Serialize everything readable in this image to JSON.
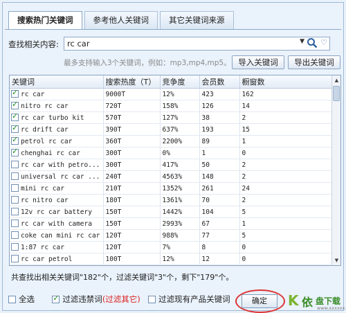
{
  "tabs": [
    "搜索热门关键词",
    "参考他人关键词",
    "其它关键词来源"
  ],
  "search": {
    "label": "查找相关内容:",
    "value": "rc car",
    "hint": "最多支持输入3个关键词，例如：mp3,mp4,mp5。",
    "import_label": "导入关键词",
    "export_label": "导出关键词"
  },
  "icons": {
    "dropdown": "chevron-down-icon",
    "search": "search-icon",
    "favorite": "heart-icon"
  },
  "table": {
    "columns": [
      "关键词",
      "搜索热度（T）",
      "竞争度",
      "会员数",
      "橱窗数"
    ],
    "rows": [
      {
        "checked": true,
        "kw": "rc car",
        "heat": "9000T",
        "comp": "12%",
        "members": "423",
        "windows": "162"
      },
      {
        "checked": true,
        "kw": "nitro rc car",
        "heat": "720T",
        "comp": "158%",
        "members": "126",
        "windows": "14"
      },
      {
        "checked": true,
        "kw": "rc car turbo kit",
        "heat": "570T",
        "comp": "127%",
        "members": "38",
        "windows": "2"
      },
      {
        "checked": true,
        "kw": "rc drift car",
        "heat": "390T",
        "comp": "637%",
        "members": "193",
        "windows": "15"
      },
      {
        "checked": true,
        "kw": "petrol rc car",
        "heat": "360T",
        "comp": "2200%",
        "members": "89",
        "windows": "1"
      },
      {
        "checked": true,
        "kw": "chenghai rc car",
        "heat": "300T",
        "comp": "0%",
        "members": "1",
        "windows": "0"
      },
      {
        "checked": false,
        "kw": "rc car with petro...",
        "heat": "300T",
        "comp": "417%",
        "members": "50",
        "windows": "2"
      },
      {
        "checked": false,
        "kw": "universal rc car ...",
        "heat": "240T",
        "comp": "4563%",
        "members": "148",
        "windows": "2"
      },
      {
        "checked": false,
        "kw": "mini rc car",
        "heat": "210T",
        "comp": "1352%",
        "members": "261",
        "windows": "24"
      },
      {
        "checked": false,
        "kw": "rc nitro car",
        "heat": "180T",
        "comp": "1361%",
        "members": "70",
        "windows": "2"
      },
      {
        "checked": false,
        "kw": "12v rc car battery",
        "heat": "150T",
        "comp": "1442%",
        "members": "104",
        "windows": "5"
      },
      {
        "checked": false,
        "kw": "rc car with camera",
        "heat": "150T",
        "comp": "2993%",
        "members": "67",
        "windows": "1"
      },
      {
        "checked": false,
        "kw": "coke can mini rc car",
        "heat": "120T",
        "comp": "988%",
        "members": "77",
        "windows": "5"
      },
      {
        "checked": false,
        "kw": "1:87 rc car",
        "heat": "120T",
        "comp": "7%",
        "members": "8",
        "windows": "0"
      },
      {
        "checked": false,
        "kw": "rc car petrol",
        "heat": "100T",
        "comp": "12%",
        "members": "12",
        "windows": "0"
      }
    ]
  },
  "summary": "共查找出相关关键词\"182\"个，过滤关键词\"3\"个，剩下\"179\"个。",
  "footer": {
    "select_all": "全选",
    "filter_banned": "过滤违禁词",
    "filter_other": "(过滤其它)",
    "filter_existing": "过滤现有产品关键词",
    "ok": "确定"
  },
  "watermark": {
    "glyph": "K",
    "text1": "依",
    "text2": "盘下载",
    "url": "www.xxxxxx.com"
  }
}
